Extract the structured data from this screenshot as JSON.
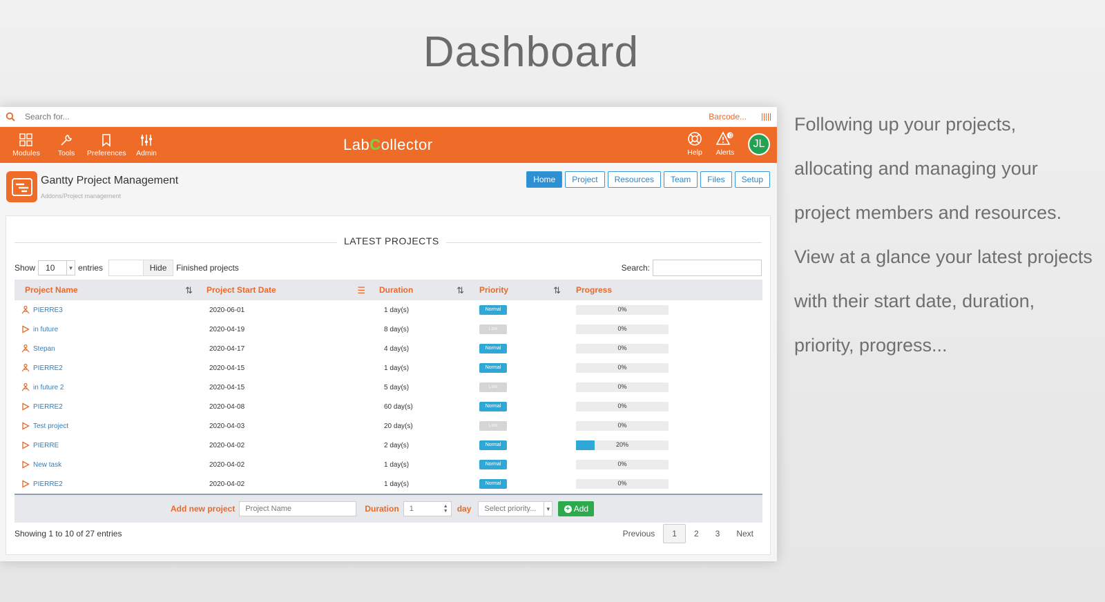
{
  "heading": "Dashboard",
  "search": {
    "placeholder": "Search for...",
    "barcode_label": "Barcode..."
  },
  "toolbar": {
    "modules": "Modules",
    "tools": "Tools",
    "preferences": "Preferences",
    "admin": "Admin",
    "logo_pre": "Lab",
    "logo_c": "C",
    "logo_post": "ollector",
    "help": "Help",
    "alerts": "Alerts",
    "alerts_count": "0",
    "avatar_initials": "JL"
  },
  "app": {
    "title": "Gantty Project Management",
    "breadcrumb": "Addons/Project management",
    "tabs": [
      "Home",
      "Project",
      "Resources",
      "Team",
      "Files",
      "Setup"
    ],
    "active_tab": "Home"
  },
  "panel": {
    "title": "LATEST PROJECTS",
    "show_label": "Show",
    "entries_value": "10",
    "entries_label": "entries",
    "hide_label": "Hide",
    "finished_label": "Finished projects",
    "search_label": "Search:"
  },
  "table": {
    "columns": [
      "Project Name",
      "Project Start Date",
      "Duration",
      "Priority",
      "Progress"
    ],
    "rows": [
      {
        "name": "PIERRE3",
        "icon": "person-icon",
        "date": "2020-06-01",
        "duration": "1 day(s)",
        "priority": "Normal",
        "progress": 0,
        "progress_text": "0%"
      },
      {
        "name": "in future",
        "icon": "play-icon",
        "date": "2020-04-19",
        "duration": "8 day(s)",
        "priority": "Low",
        "progress": 0,
        "progress_text": "0%"
      },
      {
        "name": "Stepan",
        "icon": "person-icon",
        "date": "2020-04-17",
        "duration": "4 day(s)",
        "priority": "Normal",
        "progress": 0,
        "progress_text": "0%"
      },
      {
        "name": "PIERRE2",
        "icon": "person-icon",
        "date": "2020-04-15",
        "duration": "1 day(s)",
        "priority": "Normal",
        "progress": 0,
        "progress_text": "0%"
      },
      {
        "name": "in future 2",
        "icon": "person-icon",
        "date": "2020-04-15",
        "duration": "5 day(s)",
        "priority": "Low",
        "progress": 0,
        "progress_text": "0%"
      },
      {
        "name": "PIERRE2",
        "icon": "play-icon",
        "date": "2020-04-08",
        "duration": "60 day(s)",
        "priority": "Normal",
        "progress": 0,
        "progress_text": "0%"
      },
      {
        "name": "Test project",
        "icon": "play-icon",
        "date": "2020-04-03",
        "duration": "20 day(s)",
        "priority": "Low",
        "progress": 0,
        "progress_text": "0%"
      },
      {
        "name": "PIERRE",
        "icon": "play-icon",
        "date": "2020-04-02",
        "duration": "2 day(s)",
        "priority": "Normal",
        "progress": 20,
        "progress_text": "20%"
      },
      {
        "name": "New task",
        "icon": "play-icon",
        "date": "2020-04-02",
        "duration": "1 day(s)",
        "priority": "Normal",
        "progress": 0,
        "progress_text": "0%"
      },
      {
        "name": "PIERRE2",
        "icon": "play-icon",
        "date": "2020-04-02",
        "duration": "1 day(s)",
        "priority": "Normal",
        "progress": 0,
        "progress_text": "0%"
      }
    ]
  },
  "add_project": {
    "label": "Add new project",
    "name_placeholder": "Project Name",
    "duration_label": "Duration",
    "duration_value": "1",
    "day_label": "day",
    "priority_placeholder": "Select priority...",
    "add_label": "Add"
  },
  "footer": {
    "showing": "Showing 1 to 10 of 27 entries",
    "previous": "Previous",
    "pages": [
      "1",
      "2",
      "3"
    ],
    "next": "Next"
  },
  "side_text": [
    "Following up your projects,",
    "allocating and managing your",
    "project members and resources.",
    "View at a glance your latest projects",
    "with their start date, duration,",
    "priority, progress..."
  ],
  "colors": {
    "brand": "#ef6c28",
    "accent": "#2fa8d8",
    "add": "#2daa4e"
  }
}
